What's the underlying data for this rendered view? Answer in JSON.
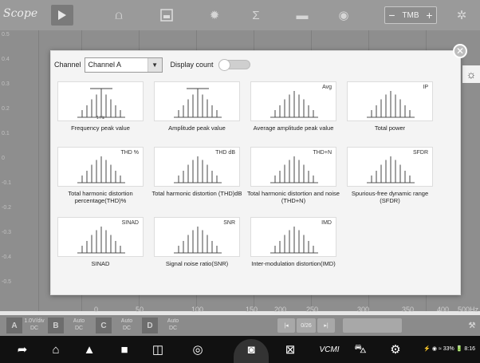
{
  "app": {
    "logo": "Scope"
  },
  "toolbar": {
    "timebase": "TMB",
    "minus": "−",
    "plus": "+"
  },
  "scope": {
    "left_ticks": [
      "0.5",
      "0.4",
      "0.3",
      "0.2",
      "0.1",
      "0",
      "-0.1",
      "-0.2",
      "-0.3",
      "-0.4",
      "-0.5"
    ],
    "x_ticks": [
      "0",
      "50",
      "100",
      "150",
      "200",
      "250",
      "300",
      "350",
      "400"
    ],
    "x_unit": "500Hz"
  },
  "modal": {
    "channel_label": "Channel",
    "channel_value": "Channel A",
    "display_count_label": "Display count",
    "display_count_on": false,
    "cards": [
      {
        "label": "Frequency peak value",
        "tag": "",
        "sub": "1 Hz",
        "style": "line-peak"
      },
      {
        "label": "Amplitude peak value",
        "tag": "",
        "sub": "",
        "style": "line-peak"
      },
      {
        "label": "Average amplitude peak value",
        "tag": "Avg",
        "sub": "",
        "style": "plain"
      },
      {
        "label": "Total power",
        "tag": "IP",
        "sub": "",
        "style": "plain"
      },
      {
        "label": "Total harmonic distortion percentage(THD)%",
        "tag": "THD %",
        "sub": "",
        "style": "plain"
      },
      {
        "label": "Total harmonic distortion (THD)dB",
        "tag": "THD dB",
        "sub": "",
        "style": "plain"
      },
      {
        "label": "Total harmonic distortion and noise (THD+N)",
        "tag": "THD+N",
        "sub": "",
        "style": "plain"
      },
      {
        "label": "Spurious-free dynamic range (SFDR)",
        "tag": "SFDR",
        "sub": "",
        "style": "plain"
      },
      {
        "label": "SINAD",
        "tag": "SINAD",
        "sub": "",
        "style": "plain"
      },
      {
        "label": "Signal noise ratio(SNR)",
        "tag": "SNR",
        "sub": "",
        "style": "plain"
      },
      {
        "label": "Inter-modulation distortion(IMD)",
        "tag": "IMD",
        "sub": "",
        "style": "plain"
      }
    ]
  },
  "channels": [
    {
      "id": "A",
      "line1": "1.0V/div",
      "line2": "DC"
    },
    {
      "id": "B",
      "line1": "Auto",
      "line2": "DC"
    },
    {
      "id": "C",
      "line1": "Auto",
      "line2": "DC"
    },
    {
      "id": "D",
      "line1": "Auto",
      "line2": "DC"
    }
  ],
  "bottom_controls": {
    "page": "0/26"
  },
  "navbar": {
    "vcmi": "VCMI",
    "status": "⚡ ◉ ≈ 33% 🔋 8:16"
  },
  "colors": {
    "accent": "#4a4a4a",
    "modal_bg": "#f4f4f4",
    "dim": "#8e8e8e"
  }
}
